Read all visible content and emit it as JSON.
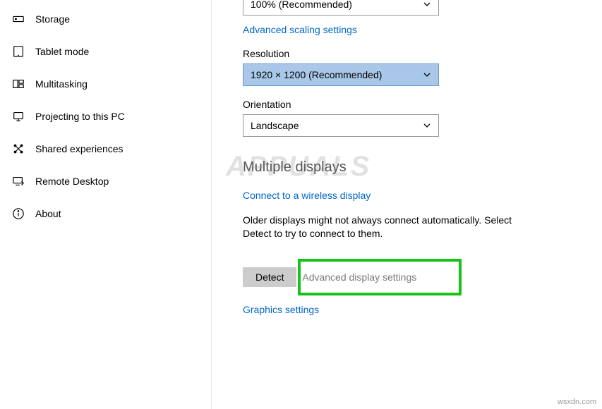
{
  "sidebar": {
    "items": [
      {
        "label": "Storage"
      },
      {
        "label": "Tablet mode"
      },
      {
        "label": "Multitasking"
      },
      {
        "label": "Projecting to this PC"
      },
      {
        "label": "Shared experiences"
      },
      {
        "label": "Remote Desktop"
      },
      {
        "label": "About"
      }
    ]
  },
  "main": {
    "scale_dropdown": {
      "value": "100% (Recommended)"
    },
    "adv_scaling_link": "Advanced scaling settings",
    "resolution_label": "Resolution",
    "resolution_dropdown": {
      "value": "1920 × 1200 (Recommended)"
    },
    "orientation_label": "Orientation",
    "orientation_dropdown": {
      "value": "Landscape"
    },
    "multiple_displays_heading": "Multiple displays",
    "connect_wireless_link": "Connect to a wireless display",
    "older_displays_text": "Older displays might not always connect automatically. Select Detect to try to connect to them.",
    "detect_button": "Detect",
    "adv_display_link": "Advanced display settings",
    "graphics_settings_link": "Graphics settings"
  },
  "watermark": "APPUALS",
  "source": "wsxdn.com"
}
